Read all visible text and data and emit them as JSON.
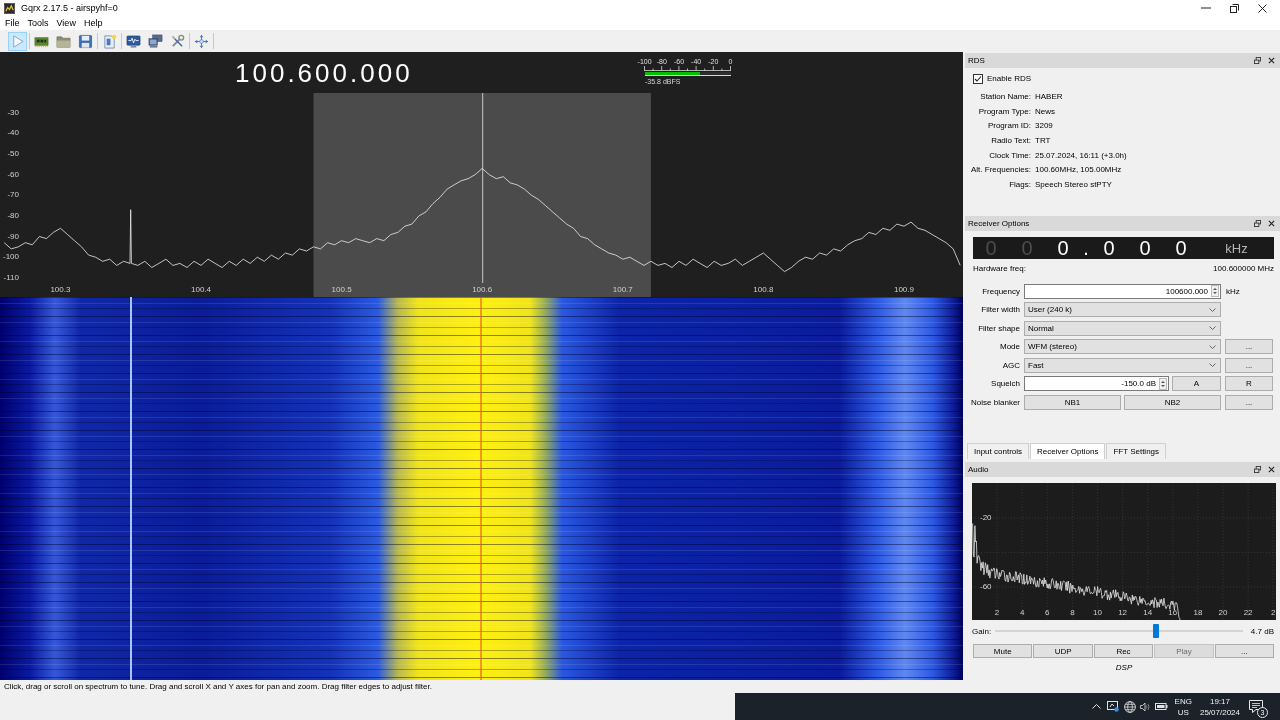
{
  "window": {
    "title": "Gqrx 2.17.5 - airspyhf=0"
  },
  "menu": [
    "File",
    "Tools",
    "View",
    "Help"
  ],
  "toolbar": {
    "groups": [
      [
        {
          "kind": "start",
          "checked": true
        }
      ],
      [
        {
          "kind": "device"
        },
        {
          "kind": "open"
        },
        {
          "kind": "save"
        }
      ],
      [
        {
          "kind": "bookmarks"
        }
      ],
      [
        {
          "kind": "display"
        },
        {
          "kind": "remote"
        },
        {
          "kind": "settings"
        }
      ],
      [
        {
          "kind": "center"
        }
      ]
    ]
  },
  "spectrum": {
    "frequency": "100.600.000",
    "meter": {
      "scale": [
        "-100",
        "-80",
        "-60",
        "-40",
        "-20",
        "0"
      ],
      "level": 0.642,
      "reading": "-35.8 dBFS"
    },
    "chart_data": [
      {
        "type": "line",
        "color": "#ececec",
        "xlim": [
          100.257,
          100.942
        ],
        "ylim": [
          -119.3,
          -0.6
        ],
        "xticks": [
          100.3,
          100.4,
          100.5,
          100.6,
          100.7,
          100.8,
          100.9
        ],
        "yticks": [
          -30,
          -40,
          -50,
          -60,
          -70,
          -80,
          -90,
          -100,
          -110
        ],
        "bands": [
          {
            "axis": "x",
            "from": 100.48,
            "to": 100.72,
            "color": "#4b4b4b"
          }
        ],
        "ref_lines": [
          {
            "axis": "x",
            "value": 100.6,
            "color": "#c8c8c8"
          }
        ],
        "x": [
          100.26,
          100.265,
          100.27,
          100.275,
          100.28,
          100.285,
          100.29,
          100.295,
          100.3,
          100.305,
          100.31,
          100.315,
          100.32,
          100.325,
          100.33,
          100.335,
          100.34,
          100.345,
          100.3495,
          100.35,
          100.3505,
          100.355,
          100.36,
          100.365,
          100.37,
          100.375,
          100.38,
          100.385,
          100.39,
          100.395,
          100.4,
          100.405,
          100.41,
          100.415,
          100.42,
          100.425,
          100.43,
          100.435,
          100.44,
          100.445,
          100.45,
          100.455,
          100.46,
          100.465,
          100.47,
          100.475,
          100.48,
          100.485,
          100.49,
          100.495,
          100.5,
          100.505,
          100.51,
          100.515,
          100.52,
          100.525,
          100.53,
          100.535,
          100.54,
          100.545,
          100.55,
          100.555,
          100.56,
          100.565,
          100.57,
          100.575,
          100.58,
          100.585,
          100.59,
          100.595,
          100.6,
          100.605,
          100.61,
          100.615,
          100.62,
          100.625,
          100.63,
          100.635,
          100.64,
          100.645,
          100.65,
          100.655,
          100.66,
          100.665,
          100.67,
          100.675,
          100.68,
          100.685,
          100.69,
          100.695,
          100.7,
          100.705,
          100.71,
          100.715,
          100.72,
          100.725,
          100.73,
          100.735,
          100.74,
          100.745,
          100.75,
          100.755,
          100.76,
          100.765,
          100.77,
          100.775,
          100.78,
          100.785,
          100.79,
          100.795,
          100.8,
          100.805,
          100.81,
          100.815,
          100.82,
          100.825,
          100.83,
          100.835,
          100.84,
          100.845,
          100.85,
          100.855,
          100.86,
          100.865,
          100.87,
          100.875,
          100.88,
          100.885,
          100.89,
          100.895,
          100.9,
          100.905,
          100.91,
          100.915,
          100.92,
          100.925,
          100.93,
          100.935,
          100.94
        ],
        "values": [
          -93,
          -96,
          -95,
          -93,
          -94,
          -90,
          -91,
          -88,
          -86,
          -89,
          -92,
          -95,
          -99,
          -100,
          -102,
          -101,
          -104,
          -102,
          -103,
          -77,
          -103,
          -104,
          -102,
          -105,
          -103,
          -101,
          -104,
          -103,
          -105,
          -102,
          -104,
          -101,
          -103,
          -105,
          -102,
          -104,
          -101,
          -103,
          -100,
          -102,
          -99,
          -101,
          -98,
          -99,
          -96,
          -97,
          -95,
          -96,
          -93,
          -94,
          -92,
          -93,
          -91,
          -92,
          -93,
          -91,
          -92,
          -89,
          -88,
          -85,
          -84,
          -80,
          -78,
          -74,
          -71,
          -67,
          -65,
          -63,
          -62,
          -60,
          -57,
          -60,
          -62,
          -61,
          -64,
          -65,
          -67,
          -70,
          -72,
          -75,
          -78,
          -81,
          -84,
          -86,
          -90,
          -91,
          -94,
          -96,
          -98,
          -99,
          -101,
          -100,
          -102,
          -104,
          -102,
          -104,
          -103,
          -105,
          -102,
          -104,
          -101,
          -103,
          -105,
          -102,
          -104,
          -103,
          -101,
          -104,
          -102,
          -100,
          -98,
          -101,
          -104,
          -107,
          -105,
          -102,
          -100,
          -101,
          -98,
          -99,
          -96,
          -97,
          -94,
          -92,
          -91,
          -88,
          -89,
          -86,
          -87,
          -84,
          -85,
          -83,
          -86,
          -87,
          -89,
          -91,
          -93,
          -96,
          -104
        ]
      }
    ]
  },
  "rds": {
    "title": "RDS",
    "enable": {
      "label": "Enable RDS",
      "checked": true
    },
    "fields": [
      {
        "label": "Station Name:",
        "value": "HABER"
      },
      {
        "label": "Program Type:",
        "value": "News"
      },
      {
        "label": "Program ID:",
        "value": "3209"
      },
      {
        "label": "Radio Text:",
        "value": "TRT"
      },
      {
        "label": "Clock Time:",
        "value": "25.07.2024, 16:11 (+3.0h)"
      },
      {
        "label": "Alt. Frequencies:",
        "value": "100.60MHz, 105.00MHz"
      },
      {
        "label": "Flags:",
        "value": "Speech Stereo stPTY"
      }
    ]
  },
  "receiver_options": {
    "title": "Receiver Options",
    "display": {
      "digits": [
        {
          "text": "0",
          "active": false
        },
        {
          "text": "0",
          "active": false
        },
        {
          "text": "0",
          "active": true
        },
        {
          "text": ".",
          "active": true
        },
        {
          "text": "0",
          "active": true
        },
        {
          "text": "0",
          "active": true
        },
        {
          "text": "0",
          "active": true
        }
      ],
      "unit": "kHz"
    },
    "hardware": {
      "label": "Hardware freq:",
      "value": "100.600000 MHz"
    },
    "rows": [
      {
        "kind": "spin",
        "label": "Frequency",
        "value": "100600.000",
        "unit": "kHz"
      },
      {
        "kind": "combo",
        "label": "Filter width",
        "value": "User (240 k)"
      },
      {
        "kind": "combo",
        "label": "Filter shape",
        "value": "Normal"
      },
      {
        "kind": "combo",
        "label": "Mode",
        "value": "WFM (stereo)",
        "buttons": [
          "..."
        ]
      },
      {
        "kind": "combo",
        "label": "AGC",
        "value": "Fast",
        "buttons": [
          "..."
        ]
      },
      {
        "kind": "spin",
        "label": "Squelch",
        "value": "-150.0 dB",
        "buttons": [
          "A",
          "R"
        ]
      },
      {
        "kind": "buttons",
        "label": "Noise blanker",
        "buttons": [
          "NB1",
          "NB2",
          "..."
        ]
      }
    ]
  },
  "dock_tabs": [
    {
      "label": "Input controls",
      "selected": false
    },
    {
      "label": "Receiver Options",
      "selected": true
    },
    {
      "label": "FFT Settings",
      "selected": false
    }
  ],
  "audio": {
    "title": "Audio",
    "y_labels": [
      "-20",
      "-60"
    ],
    "x_labels": [
      "2",
      "4",
      "6",
      "8",
      "10",
      "12",
      "14",
      "16",
      "18",
      "20",
      "22",
      "2"
    ],
    "gain": {
      "label": "Gain:",
      "level": 0.65,
      "reading": "4.7 dB"
    },
    "buttons": [
      {
        "label": "Mute",
        "disabled": false
      },
      {
        "label": "UDP",
        "disabled": false
      },
      {
        "label": "Rec",
        "disabled": false
      },
      {
        "label": "Play",
        "disabled": true
      },
      {
        "label": "...",
        "disabled": false
      }
    ],
    "caption": "DSP"
  },
  "status_bar": "Click, drag or scroll on spectrum to tune. Drag and scroll X and Y axes for pan and zoom. Drag filter edges to adjust filter.",
  "taskbar": {
    "language": "ENG",
    "region": "US",
    "time": "19:17",
    "date": "25/07/2024",
    "notifications": "3"
  }
}
